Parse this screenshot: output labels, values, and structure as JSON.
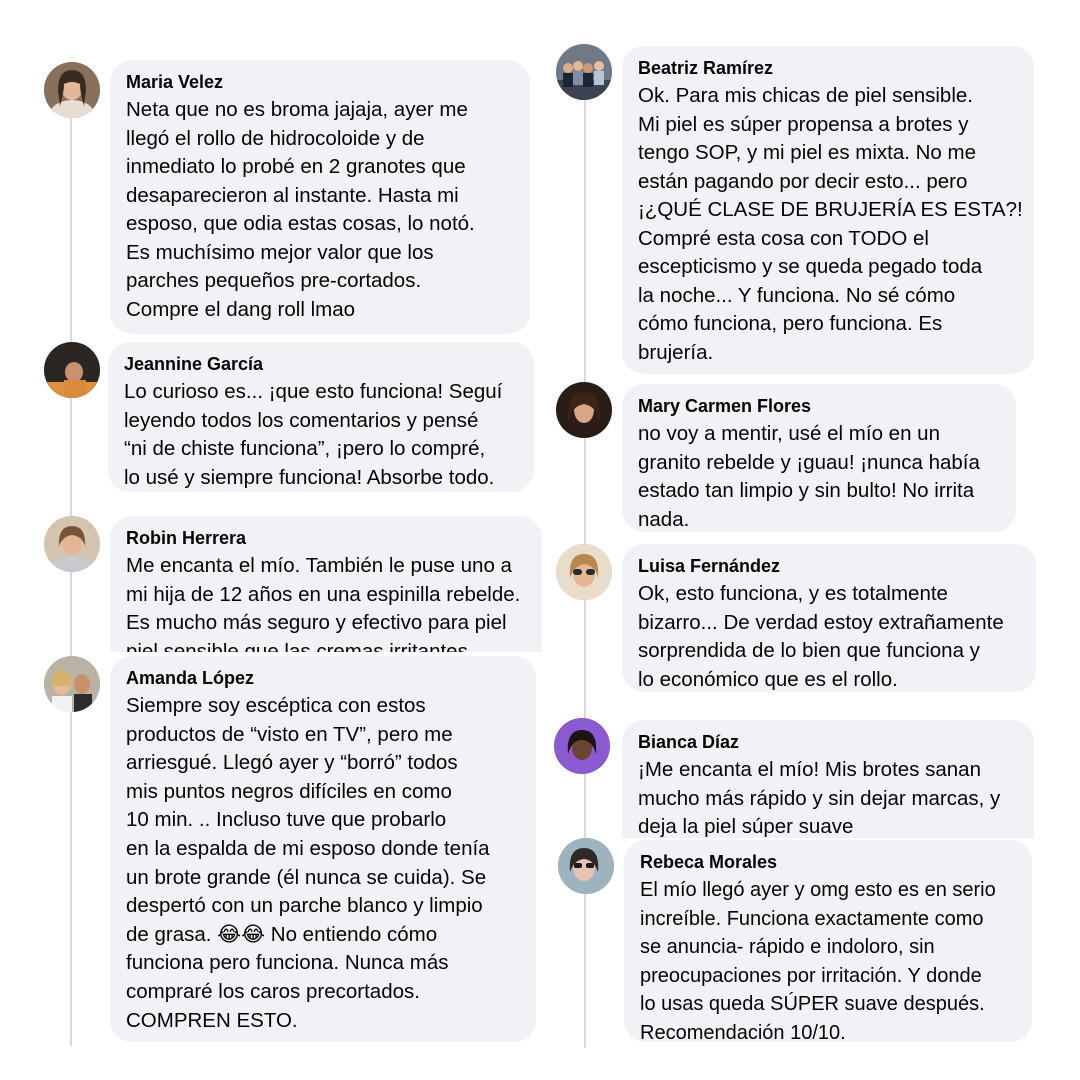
{
  "comments": [
    {
      "name": "Maria Velez",
      "lines": [
        "Neta que no es broma jajaja, ayer me",
        "llegó el rollo de hidrocoloide y de",
        "inmediato lo probé en 2 granotes que",
        "desaparecieron al instante. Hasta mi",
        "esposo, que odia estas cosas, lo notó.",
        "Es muchísimo mejor valor que los",
        "parches pequeños pre-cortados.",
        "Compre el dang roll lmao"
      ]
    },
    {
      "name": "Jeannine García",
      "lines": [
        "Lo curioso es... ¡que esto funciona! Seguí",
        "leyendo todos los comentarios y pensé",
        "“ni de chiste funciona”, ¡pero lo compré,",
        "lo usé y siempre funciona! Absorbe todo."
      ]
    },
    {
      "name": "Robin Herrera",
      "lines": [
        "Me encanta el mío. También le puse uno a",
        "mi hija de 12 años en una espinilla rebelde.",
        "Es mucho más seguro y efectivo para piel",
        "piel sensible que las cremas irritantes."
      ]
    },
    {
      "name": "Amanda López",
      "lines": [
        "Siempre soy escéptica con estos",
        "productos de “visto en TV”, pero me",
        "arriesgué. Llegó ayer y “borró” todos",
        "mis puntos negros difíciles en como",
        "10 min. .. Incluso tuve que probarlo",
        "en la espalda de mi esposo donde tenía",
        "un brote grande (él nunca se cuida). Se",
        "despertó con un parche blanco y limpio",
        "de grasa. 😂😂 No entiendo cómo",
        "funciona pero funciona. Nunca más",
        "compraré los caros precortados.",
        "COMPREN ESTO."
      ]
    },
    {
      "name": "Beatriz Ramírez",
      "lines": [
        "Ok. Para mis chicas de piel sensible.",
        "Mi piel es súper propensa a brotes y",
        "tengo SOP, y mi piel es mixta. No me",
        "están pagando por decir esto... pero",
        "¡¿QUÉ CLASE DE BRUJERÍA ES ESTA?!",
        "Compré esta cosa con TODO el",
        "escepticismo y se queda pegado toda",
        "la noche... Y funciona. No sé cómo",
        "cómo funciona, pero funciona. Es",
        "brujería."
      ]
    },
    {
      "name": "Mary Carmen Flores",
      "lines": [
        "no voy a mentir, usé el mío en un",
        "granito rebelde y ¡guau! ¡nunca había",
        "estado tan limpio y sin bulto! No irrita",
        "nada."
      ]
    },
    {
      "name": "Luisa Fernández",
      "lines": [
        "Ok, esto funciona, y es totalmente",
        "bizarro... De verdad estoy extrañamente",
        "sorprendida de lo bien que funciona y",
        "lo económico que es el rollo."
      ]
    },
    {
      "name": "Bianca Díaz",
      "lines": [
        "¡Me encanta el mío! Mis brotes sanan",
        "mucho más rápido y sin dejar marcas, y",
        "deja la piel súper suave"
      ]
    },
    {
      "name": "Rebeca Morales",
      "lines": [
        "El mío llegó ayer y omg esto es en serio",
        "increíble. Funciona exactamente como",
        "se anuncia- rápido e indoloro, sin",
        "preocupaciones por irritación. Y donde",
        "lo usas queda SÚPER suave después.",
        "Recomendación 10/10."
      ]
    }
  ]
}
